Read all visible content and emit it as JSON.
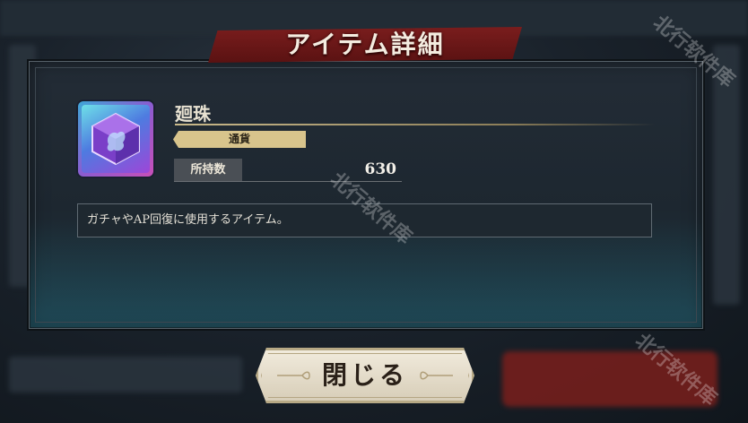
{
  "dialog": {
    "title": "アイテム詳細"
  },
  "item": {
    "name": "廻珠",
    "category": "通貨",
    "quantity_label": "所持数",
    "quantity": "630",
    "description": "ガチャやAP回復に使用するアイテム。"
  },
  "buttons": {
    "close_label": "閉じる"
  },
  "watermark": {
    "text": "北行软件库"
  },
  "colors": {
    "ribbon": "#6a1717",
    "tag": "#d8c48c",
    "panel": "#1d2730"
  }
}
